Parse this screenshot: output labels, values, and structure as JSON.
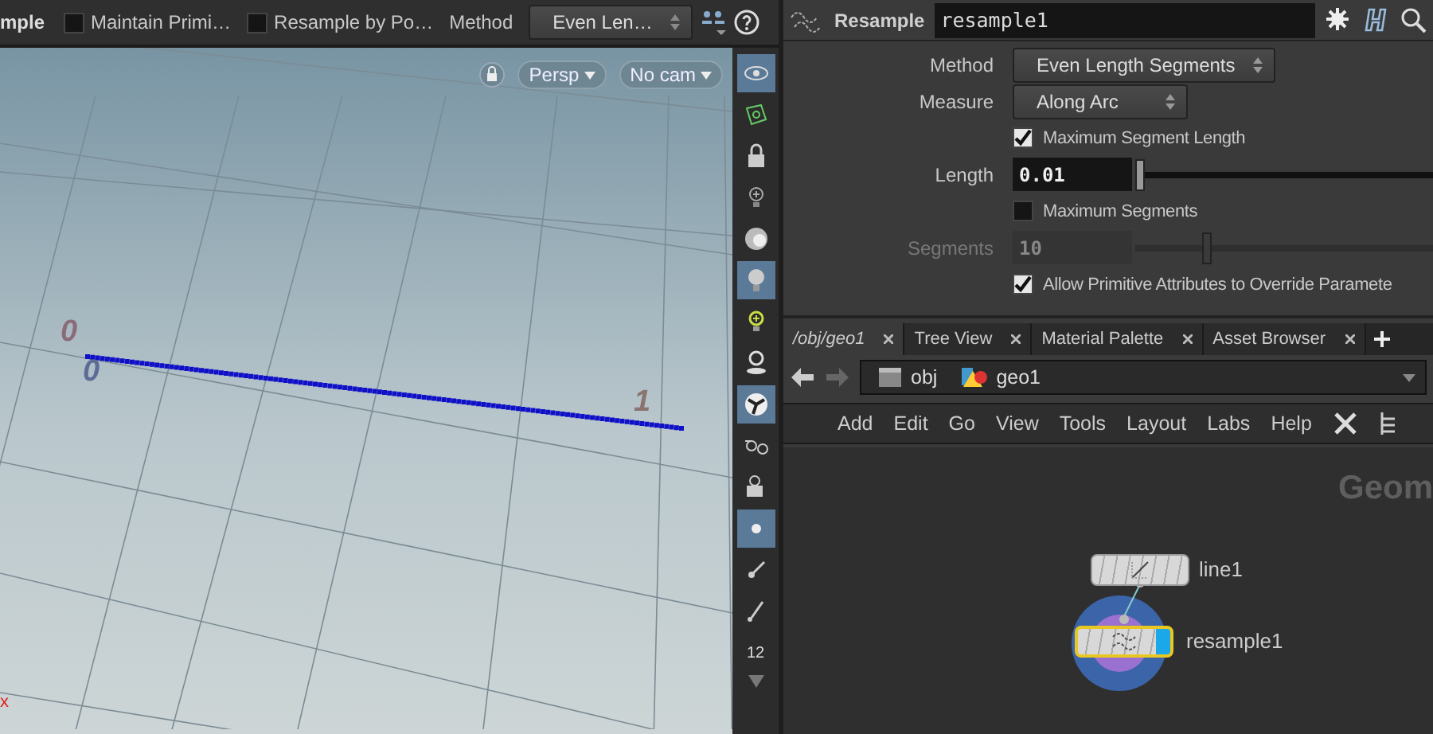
{
  "viewer_toolbar": {
    "node_label": "mple",
    "toggles": [
      {
        "label": "Maintain Primi…",
        "checked": false
      },
      {
        "label": "Resample by Po…",
        "checked": false
      }
    ],
    "method_label": "Method",
    "method_value": "Even Len…"
  },
  "viewport": {
    "camera_menus": [
      {
        "label": "Persp"
      },
      {
        "label": "No cam"
      }
    ],
    "grid_labels": [
      {
        "text": "0",
        "color": "#8a6c78"
      },
      {
        "text": "0",
        "color": "#5d6c96"
      },
      {
        "text": "1",
        "color": "#8a7470"
      }
    ],
    "axis_label": "x"
  },
  "side_toolbar": [
    {
      "selected": true
    },
    {
      "selected": false
    },
    {
      "selected": false
    },
    {
      "selected": false
    },
    {
      "selected": false
    },
    {
      "selected": true
    },
    {
      "selected": false
    },
    {
      "selected": false
    },
    {
      "selected": true
    },
    {
      "selected": false
    },
    {
      "selected": false
    },
    {
      "selected": true
    },
    {
      "selected": false
    },
    {
      "selected": false
    },
    {
      "selected": false,
      "label": "12"
    }
  ],
  "parameters": {
    "node_type": "Resample",
    "node_name": "resample1",
    "rows": [
      {
        "kind": "menu",
        "label": "Method",
        "value": "Even Length Segments"
      },
      {
        "kind": "menu",
        "label": "Measure",
        "value": "Along Arc"
      },
      {
        "kind": "toggle",
        "label": "Maximum Segment Length",
        "checked": true
      },
      {
        "kind": "slider",
        "label": "Length",
        "value": "0.01",
        "level": 0,
        "disabled": false
      },
      {
        "kind": "toggle",
        "label": "Maximum Segments",
        "checked": false
      },
      {
        "kind": "slider",
        "label": "Segments",
        "value": "10",
        "level": 0.23,
        "disabled": true
      },
      {
        "kind": "toggle",
        "label": "Allow Primitive Attributes to Override Paramete",
        "checked": true
      }
    ]
  },
  "tabs": [
    {
      "label": "/obj/geo1",
      "selected": true
    },
    {
      "label": "Tree View",
      "selected": false
    },
    {
      "label": "Material Palette",
      "selected": false
    },
    {
      "label": "Asset Browser",
      "selected": false
    }
  ],
  "path": [
    "obj",
    "geo1"
  ],
  "menu": [
    "Add",
    "Edit",
    "Go",
    "View",
    "Tools",
    "Layout",
    "Labs",
    "Help"
  ],
  "network": {
    "watermark": "Geom",
    "nodes": [
      {
        "name": "line1",
        "selected": false,
        "display": false
      },
      {
        "name": "resample1",
        "selected": true,
        "display": true
      }
    ]
  }
}
